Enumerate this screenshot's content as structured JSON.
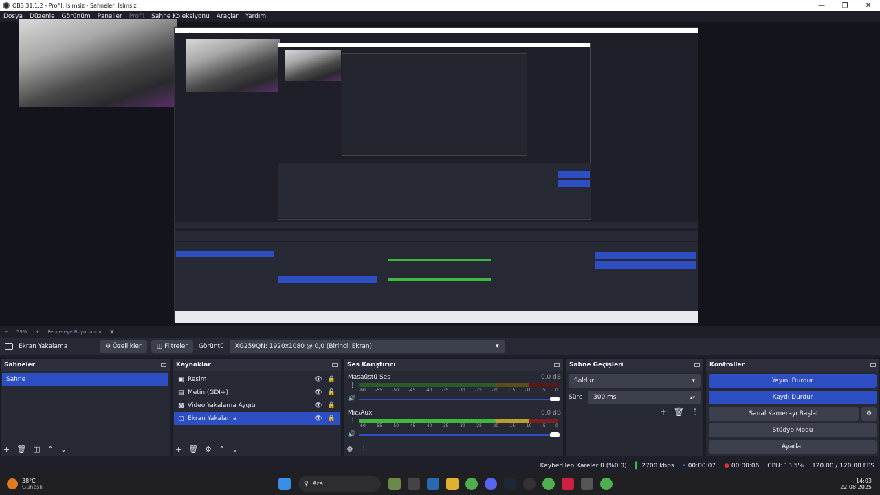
{
  "window": {
    "title": "OBS 31.1.2 - Profil: İsimsiz - Sahneler: İsimsiz"
  },
  "menu": [
    "Dosya",
    "Düzenle",
    "Görünüm",
    "Paneller",
    "Profil",
    "Sahne Koleksiyonu",
    "Araçlar",
    "Yardım"
  ],
  "preview": {
    "zoom": "59%",
    "fit_label": "Pencereye Boyutlandır"
  },
  "source_bar": {
    "selected_source": "Ekran Yakalama",
    "properties_label": "Özellikler",
    "filters_label": "Filtreler",
    "display_label": "Görüntü",
    "display_value": "XG259QN: 1920x1080 @ 0,0 (Birincil Ekran)"
  },
  "scenes": {
    "title": "Sahneler",
    "items": [
      "Sahne"
    ]
  },
  "sources": {
    "title": "Kaynaklar",
    "items": [
      "Resim",
      "Metin (GDI+)",
      "Video Yakalama Aygıtı",
      "Ekran Yakalama"
    ]
  },
  "mixer": {
    "title": "Ses Karıştırıcı",
    "channels": [
      {
        "name": "Masaüstü Ses",
        "db": "0.0 dB",
        "level": 0.0
      },
      {
        "name": "Mic/Aux",
        "db": "0.0 dB",
        "level": 0.92
      }
    ],
    "scale": [
      "-60",
      "-55",
      "-50",
      "-45",
      "-40",
      "-35",
      "-30",
      "-25",
      "-20",
      "-15",
      "-10",
      "-5",
      "0"
    ]
  },
  "transitions": {
    "title": "Sahne Geçişleri",
    "type": "Soldur",
    "duration_label": "Süre",
    "duration_value": "300 ms"
  },
  "controls": {
    "title": "Kontroller",
    "stop_stream": "Yayını Durdur",
    "stop_record": "Kaydı Durdur",
    "virtual_cam": "Sanal Kamerayı Başlat",
    "studio_mode": "Stüdyo Modu",
    "settings": "Ayarlar"
  },
  "status": {
    "dropped": "Kaybedilen Kareler 0 (%0.0)",
    "bitrate": "2700 kbps",
    "stream_time": "00:00:07",
    "rec_time": "00:00:06",
    "cpu": "CPU: 13.5%",
    "fps": "120.00 / 120.00 FPS"
  },
  "taskbar": {
    "temp": "38°C",
    "weather": "Güneşli",
    "search": "Ara",
    "time": "14:03",
    "date": "22.08.2025"
  },
  "colors": {
    "accent": "#2e4fc4",
    "bg": "#1e1f29",
    "panel": "#272935",
    "meter_green": "#3fb83f",
    "meter_yellow": "#b8a030",
    "meter_red": "#b83030"
  }
}
